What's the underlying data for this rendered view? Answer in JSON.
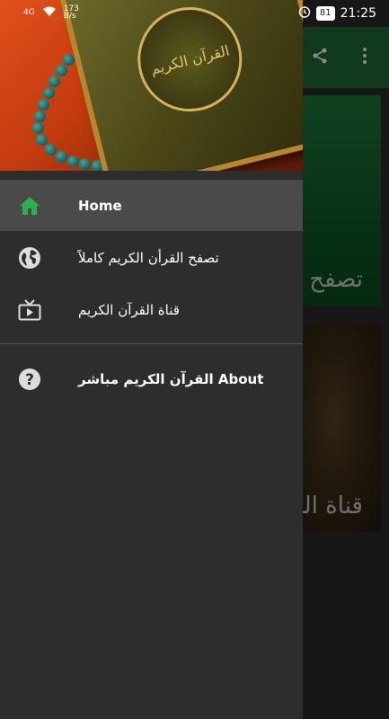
{
  "status_bar": {
    "network": "4G",
    "speed": "173\nB/s",
    "battery": "81",
    "time": "21:25"
  },
  "drawer": {
    "header_image_alt": "القرآن الكريم",
    "items": [
      {
        "label": "Home",
        "icon": "home-icon",
        "active": true
      },
      {
        "label": "تصفح القرأن الكريم كاملاً",
        "icon": "globe-icon",
        "active": false
      },
      {
        "label": "قناة القرآن الكريم",
        "icon": "tv-icon",
        "active": false
      },
      {
        "label": "القرآن الكريم مباشر About",
        "icon": "help-icon",
        "active": false
      }
    ]
  },
  "background_app": {
    "card1_label": "تصفح",
    "card2_label": "قناة الق"
  },
  "colors": {
    "accent": "#1f6b35",
    "home_icon": "#2db04b",
    "drawer_bg": "#2d2d2d",
    "active_item_bg": "#4a4a4a"
  }
}
